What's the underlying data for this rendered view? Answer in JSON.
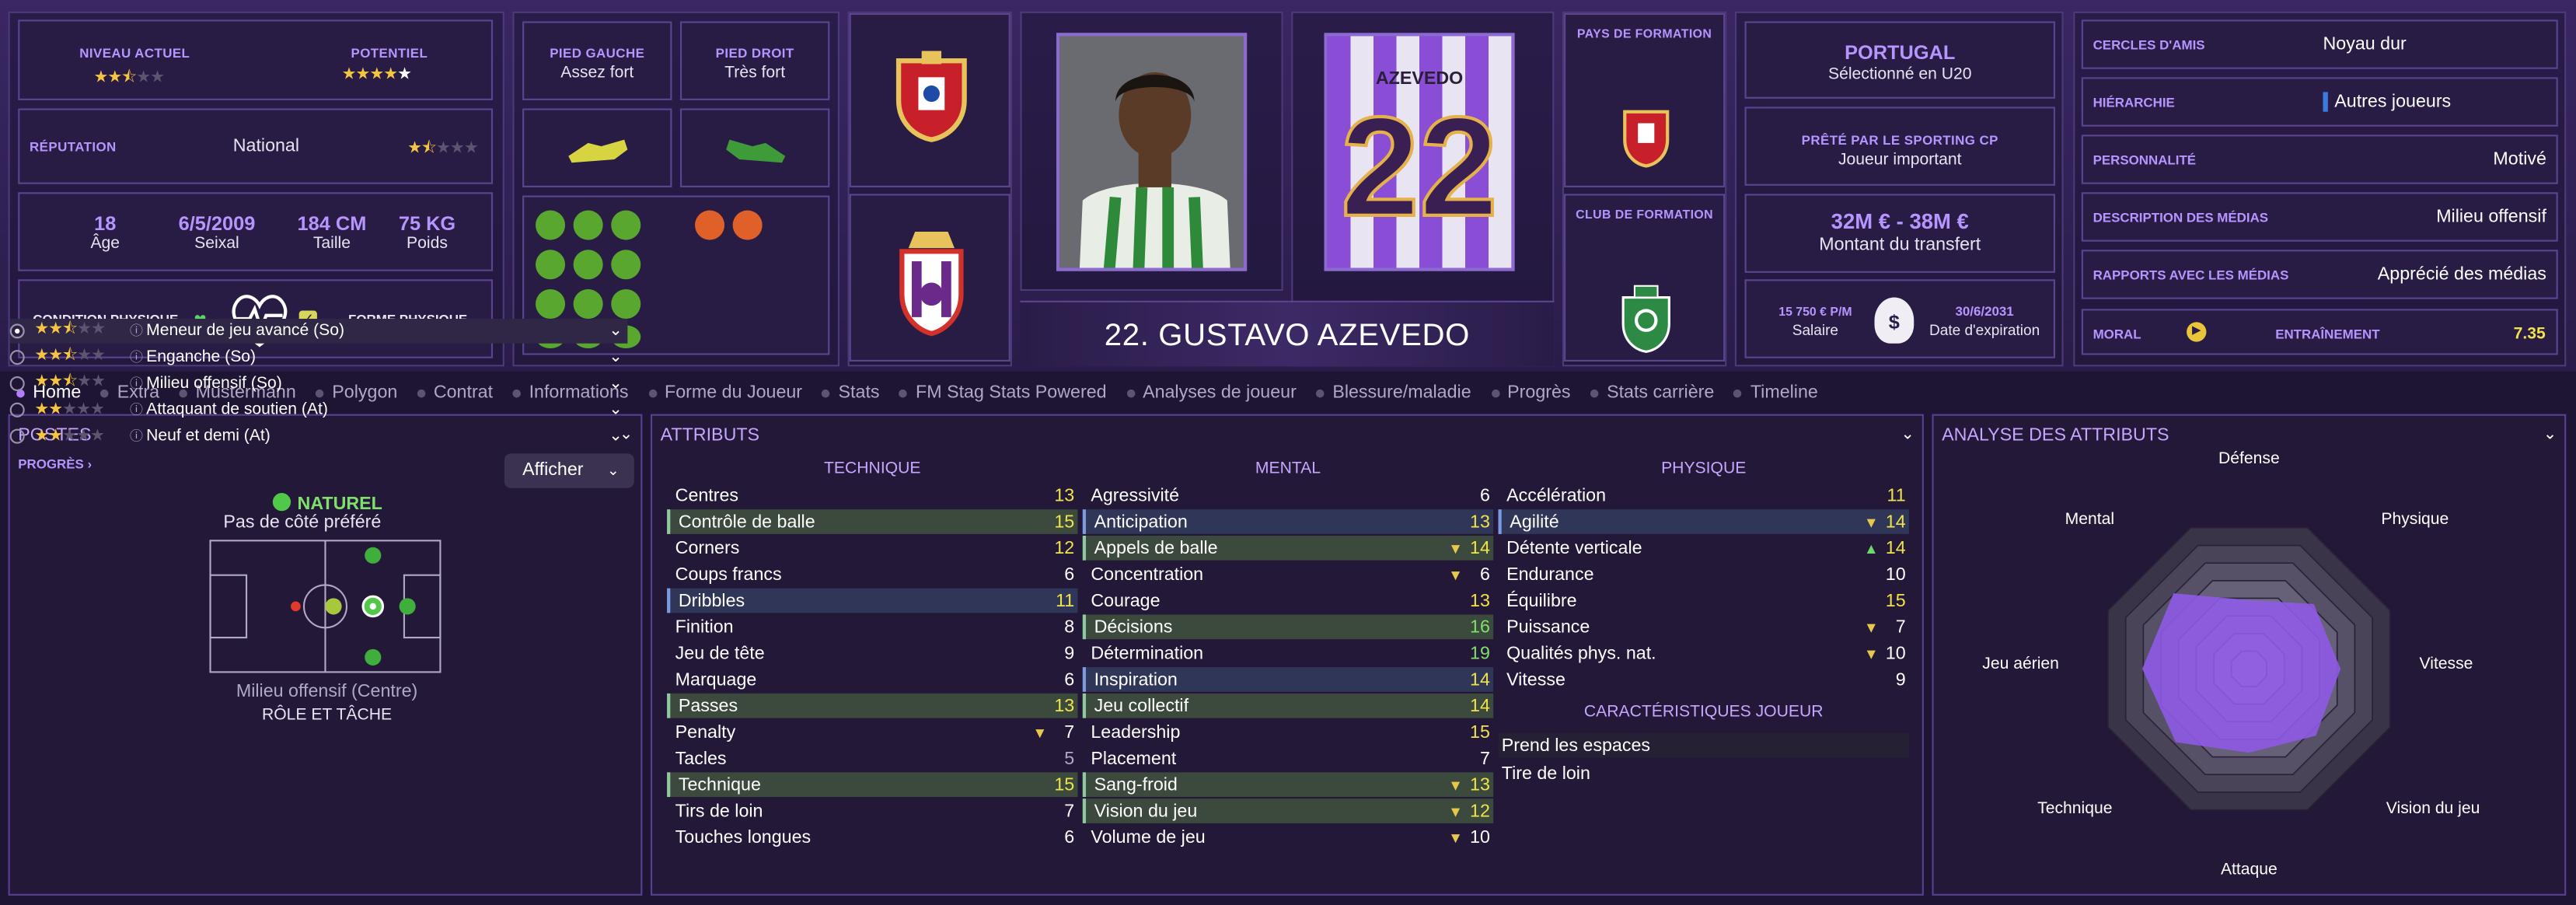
{
  "header": {
    "niveau_label": "NIVEAU ACTUEL",
    "potentiel_label": "POTENTIEL",
    "reputation_label": "RÉPUTATION",
    "reputation_value": "National",
    "age": "18",
    "age_label": "Âge",
    "birth": "6/5/2009",
    "birth_label": "Seixal",
    "height": "184 CM",
    "height_label": "Taille",
    "weight": "75 KG",
    "weight_label": "Poids",
    "condition_label": "CONDITION PHYSIQUE",
    "forme_label": "FORME PHYSIQUE",
    "pied_gauche_label": "PIED GAUCHE",
    "pied_gauche": "Assez fort",
    "pied_droit_label": "PIED DROIT",
    "pied_droit": "Très fort",
    "player_name": "22. GUSTAVO AZEVEDO",
    "shirt_name": "AZEVEDO",
    "shirt_number": "22",
    "pays_formation_label": "PAYS DE FORMATION",
    "club_formation_label": "CLUB DE FORMATION",
    "nation": "PORTUGAL",
    "nation_sub": "Sélectionné en U20",
    "loan_label": "PRÊTÉ PAR LE SPORTING CP",
    "loan_value": "Joueur important",
    "transfer_value": "32M € - 38M €",
    "transfer_label": "Montant du transfert",
    "wage": "15 750 € P/M",
    "wage_label": "Salaire",
    "expiry": "30/6/2031",
    "expiry_label": "Date d'expiration"
  },
  "ratings": {
    "current_stars": 2.5,
    "potential_stars": 4.5,
    "reputation_stars": 1.5
  },
  "right_info": [
    {
      "key": "CERCLES D'AMIS",
      "value": "Noyau dur"
    },
    {
      "key": "HIÉRARCHIE",
      "value": "Autres joueurs"
    },
    {
      "key": "PERSONNALITÉ",
      "value": "Motivé"
    },
    {
      "key": "DESCRIPTION DES MÉDIAS",
      "value": "Milieu offensif"
    },
    {
      "key": "RAPPORTS AVEC LES MÉDIAS",
      "value": "Apprécié des médias"
    }
  ],
  "morale": {
    "moral_label": "MORAL",
    "training_label": "ENTRAÎNEMENT",
    "training_value": "7.35"
  },
  "tabs": [
    "Home",
    "Extra",
    "Mustermann",
    "Polygon",
    "Contrat",
    "Informations",
    "Forme du Joueur",
    "Stats",
    "FM Stag Stats Powered",
    "Analyses de joueur",
    "Blessure/maladie",
    "Progrès",
    "Stats carrière",
    "Timeline"
  ],
  "postes": {
    "title": "POSTES",
    "progres": "PROGRÈS",
    "afficher": "Afficher",
    "naturel": "NATUREL",
    "side": "Pas de côté préféré",
    "position": "Milieu offensif (Centre)",
    "role_title": "RÔLE ET TÂCHE",
    "roles": [
      {
        "name": "Meneur de jeu avancé (So)",
        "stars": 2.5,
        "selected": true
      },
      {
        "name": "Enganche (So)",
        "stars": 2.5,
        "selected": false
      },
      {
        "name": "Milieu offensif (So)",
        "stars": 2.5,
        "selected": false
      },
      {
        "name": "Attaquant de soutien (At)",
        "stars": 2,
        "selected": false
      },
      {
        "name": "Neuf et demi (At)",
        "stars": 2,
        "selected": false
      }
    ]
  },
  "attributes": {
    "title": "ATTRIBUTS",
    "technique_label": "TECHNIQUE",
    "mental_label": "MENTAL",
    "physique_label": "PHYSIQUE",
    "technique": [
      {
        "n": "Centres",
        "v": "13",
        "c": "#f0e24a",
        "h": ""
      },
      {
        "n": "Contrôle de balle",
        "v": "15",
        "c": "#f0e24a",
        "h": "hl"
      },
      {
        "n": "Corners",
        "v": "12",
        "c": "#f0e24a",
        "h": ""
      },
      {
        "n": "Coups francs",
        "v": "6",
        "c": "#ffffff",
        "h": ""
      },
      {
        "n": "Dribbles",
        "v": "11",
        "c": "#f0e24a",
        "h": "hb"
      },
      {
        "n": "Finition",
        "v": "8",
        "c": "#ffffff",
        "h": ""
      },
      {
        "n": "Jeu de tête",
        "v": "9",
        "c": "#ffffff",
        "h": ""
      },
      {
        "n": "Marquage",
        "v": "6",
        "c": "#ffffff",
        "h": ""
      },
      {
        "n": "Passes",
        "v": "13",
        "c": "#f0e24a",
        "h": "hl"
      },
      {
        "n": "Penalty",
        "v": "7",
        "c": "#ffffff",
        "h": "",
        "a": "▼"
      },
      {
        "n": "Tacles",
        "v": "5",
        "c": "#b0a8c4",
        "h": ""
      },
      {
        "n": "Technique",
        "v": "15",
        "c": "#f0e24a",
        "h": "hl"
      },
      {
        "n": "Tirs de loin",
        "v": "7",
        "c": "#ffffff",
        "h": ""
      },
      {
        "n": "Touches longues",
        "v": "6",
        "c": "#ffffff",
        "h": ""
      }
    ],
    "mental": [
      {
        "n": "Agressivité",
        "v": "6",
        "c": "#ffffff",
        "h": ""
      },
      {
        "n": "Anticipation",
        "v": "13",
        "c": "#f0e24a",
        "h": "hb"
      },
      {
        "n": "Appels de balle",
        "v": "14",
        "c": "#f0e24a",
        "h": "hl",
        "a": "▼"
      },
      {
        "n": "Concentration",
        "v": "6",
        "c": "#ffffff",
        "h": "",
        "a": "▼"
      },
      {
        "n": "Courage",
        "v": "13",
        "c": "#f0e24a",
        "h": ""
      },
      {
        "n": "Décisions",
        "v": "16",
        "c": "#7ee06a",
        "h": "hl"
      },
      {
        "n": "Détermination",
        "v": "19",
        "c": "#7ee06a",
        "h": ""
      },
      {
        "n": "Inspiration",
        "v": "14",
        "c": "#f0e24a",
        "h": "hb"
      },
      {
        "n": "Jeu collectif",
        "v": "14",
        "c": "#f0e24a",
        "h": "hl"
      },
      {
        "n": "Leadership",
        "v": "15",
        "c": "#f0e24a",
        "h": ""
      },
      {
        "n": "Placement",
        "v": "7",
        "c": "#ffffff",
        "h": ""
      },
      {
        "n": "Sang-froid",
        "v": "13",
        "c": "#f0e24a",
        "h": "hl",
        "a": "▼"
      },
      {
        "n": "Vision du jeu",
        "v": "12",
        "c": "#f0e24a",
        "h": "hl",
        "a": "▼"
      },
      {
        "n": "Volume de jeu",
        "v": "10",
        "c": "#ffffff",
        "h": "",
        "a": "▼"
      }
    ],
    "physique": [
      {
        "n": "Accélération",
        "v": "11",
        "c": "#f0e24a",
        "h": ""
      },
      {
        "n": "Agilité",
        "v": "14",
        "c": "#f0e24a",
        "h": "hb",
        "a": "▼"
      },
      {
        "n": "Détente verticale",
        "v": "14",
        "c": "#f0e24a",
        "h": "",
        "a": "▲"
      },
      {
        "n": "Endurance",
        "v": "10",
        "c": "#ffffff",
        "h": ""
      },
      {
        "n": "Équilibre",
        "v": "15",
        "c": "#f0e24a",
        "h": ""
      },
      {
        "n": "Puissance",
        "v": "7",
        "c": "#ffffff",
        "h": "",
        "a": "▼"
      },
      {
        "n": "Qualités phys. nat.",
        "v": "10",
        "c": "#ffffff",
        "h": "",
        "a": "▼"
      },
      {
        "n": "Vitesse",
        "v": "9",
        "c": "#ffffff",
        "h": ""
      }
    ],
    "traits_label": "CARACTÉRISTIQUES JOUEUR",
    "traits": [
      "Prend les espaces",
      "Tire de loin"
    ]
  },
  "analysis": {
    "title": "ANALYSE DES ATTRIBUTS",
    "axes": [
      "Défense",
      "Physique",
      "Vitesse",
      "Vision du jeu",
      "Attaque",
      "Technique",
      "Jeu aérien",
      "Mental"
    ],
    "values": [
      0.45,
      0.6,
      0.6,
      0.62,
      0.55,
      0.68,
      0.7,
      0.7
    ]
  }
}
